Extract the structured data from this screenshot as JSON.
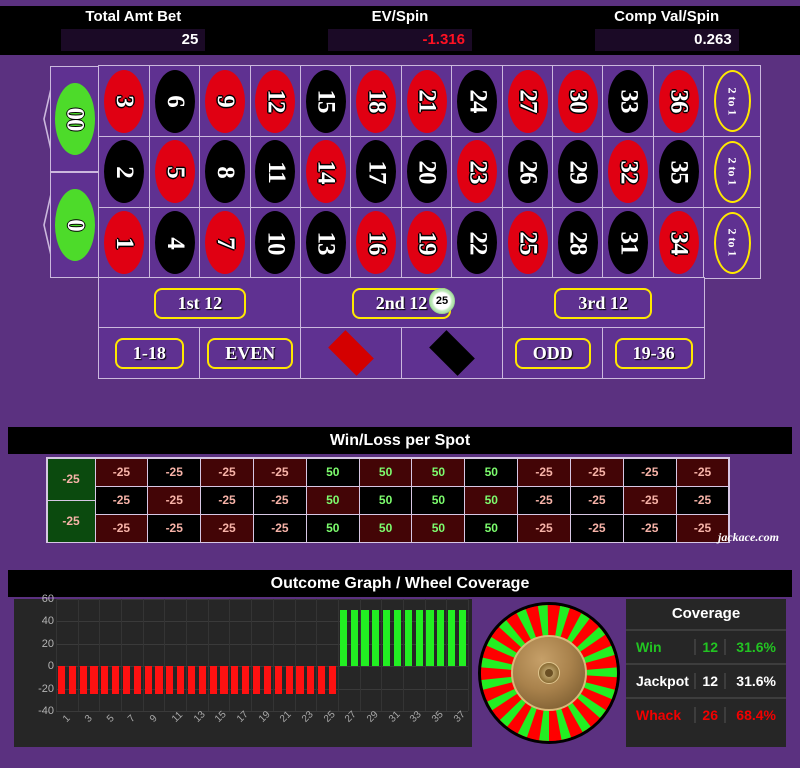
{
  "stats": [
    {
      "label": "Total Amt Bet",
      "value": "25",
      "negative": false
    },
    {
      "label": "EV/Spin",
      "value": "-1.316",
      "negative": true
    },
    {
      "label": "Comp Val/Spin",
      "value": "0.263",
      "negative": false
    }
  ],
  "table": {
    "zeros": [
      {
        "label": "00",
        "color": "green"
      },
      {
        "label": "0",
        "color": "green"
      }
    ],
    "numbers": [
      {
        "n": "3",
        "c": "red"
      },
      {
        "n": "6",
        "c": "black"
      },
      {
        "n": "9",
        "c": "red"
      },
      {
        "n": "12",
        "c": "red"
      },
      {
        "n": "15",
        "c": "black"
      },
      {
        "n": "18",
        "c": "red"
      },
      {
        "n": "21",
        "c": "red"
      },
      {
        "n": "24",
        "c": "black"
      },
      {
        "n": "27",
        "c": "red"
      },
      {
        "n": "30",
        "c": "red"
      },
      {
        "n": "33",
        "c": "black"
      },
      {
        "n": "36",
        "c": "red"
      },
      {
        "n": "2",
        "c": "black"
      },
      {
        "n": "5",
        "c": "red"
      },
      {
        "n": "8",
        "c": "black"
      },
      {
        "n": "11",
        "c": "black"
      },
      {
        "n": "14",
        "c": "red"
      },
      {
        "n": "17",
        "c": "black"
      },
      {
        "n": "20",
        "c": "black"
      },
      {
        "n": "23",
        "c": "red"
      },
      {
        "n": "26",
        "c": "black"
      },
      {
        "n": "29",
        "c": "black"
      },
      {
        "n": "32",
        "c": "red"
      },
      {
        "n": "35",
        "c": "black"
      },
      {
        "n": "1",
        "c": "red"
      },
      {
        "n": "4",
        "c": "black"
      },
      {
        "n": "7",
        "c": "red"
      },
      {
        "n": "10",
        "c": "black"
      },
      {
        "n": "13",
        "c": "black"
      },
      {
        "n": "16",
        "c": "red"
      },
      {
        "n": "19",
        "c": "red"
      },
      {
        "n": "22",
        "c": "black"
      },
      {
        "n": "25",
        "c": "red"
      },
      {
        "n": "28",
        "c": "black"
      },
      {
        "n": "31",
        "c": "black"
      },
      {
        "n": "34",
        "c": "red"
      }
    ],
    "column_bets": [
      "2 to 1",
      "2 to 1",
      "2 to 1"
    ],
    "dozens": [
      "1st 12",
      "2nd 12",
      "3rd 12"
    ],
    "outside": [
      {
        "label": "1-18",
        "type": "text"
      },
      {
        "label": "EVEN",
        "type": "text"
      },
      {
        "label": "",
        "type": "diamond-red"
      },
      {
        "label": "",
        "type": "diamond-black"
      },
      {
        "label": "ODD",
        "type": "text"
      },
      {
        "label": "19-36",
        "type": "text"
      }
    ],
    "chip": {
      "value": "25",
      "placed_on": "2nd 12"
    }
  },
  "winloss": {
    "title": "Win/Loss per Spot",
    "zero_cells": [
      "-25",
      "-25"
    ],
    "rows": [
      [
        {
          "v": "-25",
          "bg": "red"
        },
        {
          "v": "-25",
          "bg": "black"
        },
        {
          "v": "-25",
          "bg": "red"
        },
        {
          "v": "-25",
          "bg": "red"
        },
        {
          "v": "50",
          "bg": "black"
        },
        {
          "v": "50",
          "bg": "red"
        },
        {
          "v": "50",
          "bg": "red"
        },
        {
          "v": "50",
          "bg": "black"
        },
        {
          "v": "-25",
          "bg": "red"
        },
        {
          "v": "-25",
          "bg": "red"
        },
        {
          "v": "-25",
          "bg": "black"
        },
        {
          "v": "-25",
          "bg": "red"
        }
      ],
      [
        {
          "v": "-25",
          "bg": "black"
        },
        {
          "v": "-25",
          "bg": "red"
        },
        {
          "v": "-25",
          "bg": "black"
        },
        {
          "v": "-25",
          "bg": "black"
        },
        {
          "v": "50",
          "bg": "red"
        },
        {
          "v": "50",
          "bg": "black"
        },
        {
          "v": "50",
          "bg": "black"
        },
        {
          "v": "50",
          "bg": "red"
        },
        {
          "v": "-25",
          "bg": "black"
        },
        {
          "v": "-25",
          "bg": "black"
        },
        {
          "v": "-25",
          "bg": "red"
        },
        {
          "v": "-25",
          "bg": "black"
        }
      ],
      [
        {
          "v": "-25",
          "bg": "red"
        },
        {
          "v": "-25",
          "bg": "black"
        },
        {
          "v": "-25",
          "bg": "red"
        },
        {
          "v": "-25",
          "bg": "black"
        },
        {
          "v": "50",
          "bg": "black"
        },
        {
          "v": "50",
          "bg": "red"
        },
        {
          "v": "50",
          "bg": "red"
        },
        {
          "v": "50",
          "bg": "black"
        },
        {
          "v": "-25",
          "bg": "red"
        },
        {
          "v": "-25",
          "bg": "black"
        },
        {
          "v": "-25",
          "bg": "black"
        },
        {
          "v": "-25",
          "bg": "red"
        }
      ]
    ],
    "watermark": "jackace.com"
  },
  "outcome": {
    "title": "Outcome Graph / Wheel Coverage"
  },
  "coverage": {
    "title": "Coverage",
    "rows": [
      {
        "label": "Win",
        "count": "12",
        "pct": "31.6%",
        "style": "win"
      },
      {
        "label": "Jackpot",
        "count": "12",
        "pct": "31.6%",
        "style": "jackpot"
      },
      {
        "label": "Whack",
        "count": "26",
        "pct": "68.4%",
        "style": "whack"
      }
    ]
  },
  "chart_data": {
    "type": "bar",
    "title": "Outcome Graph",
    "xlabel": "",
    "ylabel": "",
    "ylim": [
      -40,
      60
    ],
    "yticks": [
      60,
      40,
      20,
      0,
      -20,
      -40
    ],
    "grid": true,
    "legend": false,
    "categories": [
      "1",
      "2",
      "3",
      "4",
      "5",
      "6",
      "7",
      "8",
      "9",
      "10",
      "11",
      "12",
      "13",
      "14",
      "15",
      "16",
      "17",
      "18",
      "19",
      "20",
      "21",
      "22",
      "23",
      "24",
      "25",
      "26",
      "27",
      "28",
      "29",
      "30",
      "31",
      "32",
      "33",
      "34",
      "35",
      "36",
      "37",
      "38"
    ],
    "xtick_labels": [
      "1",
      "3",
      "5",
      "7",
      "9",
      "11",
      "13",
      "15",
      "17",
      "19",
      "21",
      "23",
      "25",
      "27",
      "29",
      "31",
      "33",
      "35",
      "37"
    ],
    "values": [
      -25,
      -25,
      -25,
      -25,
      -25,
      -25,
      -25,
      -25,
      -25,
      -25,
      -25,
      -25,
      -25,
      -25,
      -25,
      -25,
      -25,
      -25,
      -25,
      -25,
      -25,
      -25,
      -25,
      -25,
      -25,
      -25,
      50,
      50,
      50,
      50,
      50,
      50,
      50,
      50,
      50,
      50,
      50,
      50
    ],
    "bar_colors": [
      "#ff1111",
      "#ff1111",
      "#ff1111",
      "#ff1111",
      "#ff1111",
      "#ff1111",
      "#ff1111",
      "#ff1111",
      "#ff1111",
      "#ff1111",
      "#ff1111",
      "#ff1111",
      "#ff1111",
      "#ff1111",
      "#ff1111",
      "#ff1111",
      "#ff1111",
      "#ff1111",
      "#ff1111",
      "#ff1111",
      "#ff1111",
      "#ff1111",
      "#ff1111",
      "#ff1111",
      "#ff1111",
      "#ff1111",
      "#22ef22",
      "#22ef22",
      "#22ef22",
      "#22ef22",
      "#22ef22",
      "#22ef22",
      "#22ef22",
      "#22ef22",
      "#22ef22",
      "#22ef22",
      "#22ef22",
      "#22ef22"
    ]
  },
  "wheel": {
    "segment_count": 38,
    "colors": [
      "#ff0000",
      "#22ef22"
    ]
  },
  "colors": {
    "background": "#5b3180",
    "felt": "#5f3191",
    "accent_yellow": "#ffe800",
    "red": "#e00012",
    "green": "#4ddb2a",
    "win_green": "#7dfd6e",
    "loss_pink": "#f7b3a8"
  }
}
